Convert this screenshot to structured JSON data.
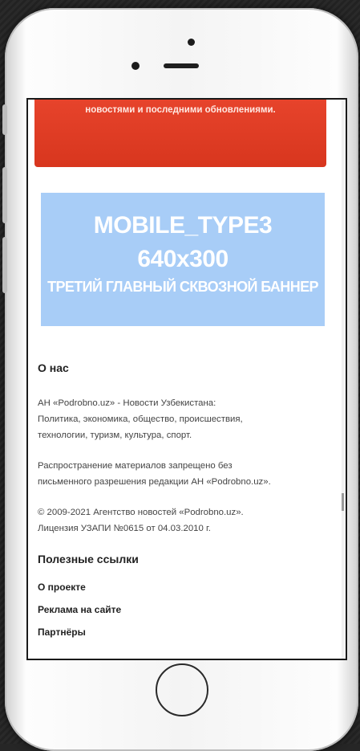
{
  "top_banner": {
    "text": "новостями и последними обновлениями."
  },
  "ad_banner": {
    "line1": "MOBILE_TYPE3",
    "line2": "640x300",
    "line3": "ТРЕТИЙ ГЛАВНЫЙ СКВОЗНОЙ БАННЕР"
  },
  "about": {
    "heading": "О нас",
    "para1": [
      "АН «Podrobno.uz» - Новости Узбекистана:",
      "Политика, экономика, общество, происшествия,",
      "технологии, туризм, культура, спорт."
    ],
    "para2": [
      "Распространение материалов запрещено без",
      "письменного разрешения редакции АН «Podrobno.uz»."
    ],
    "para3": [
      "© 2009-2021 Агентство новостей «Podrobno.uz».",
      "Лицензия УЗАПИ №0615 от 04.03.2010 г."
    ]
  },
  "useful_links": {
    "heading": "Полезные ссылки",
    "items": [
      "О проекте",
      "Реклама на сайте",
      "Партнёры"
    ]
  },
  "colors": {
    "banner_red": "#e2402a",
    "ad_blue": "#a8cdf7"
  }
}
